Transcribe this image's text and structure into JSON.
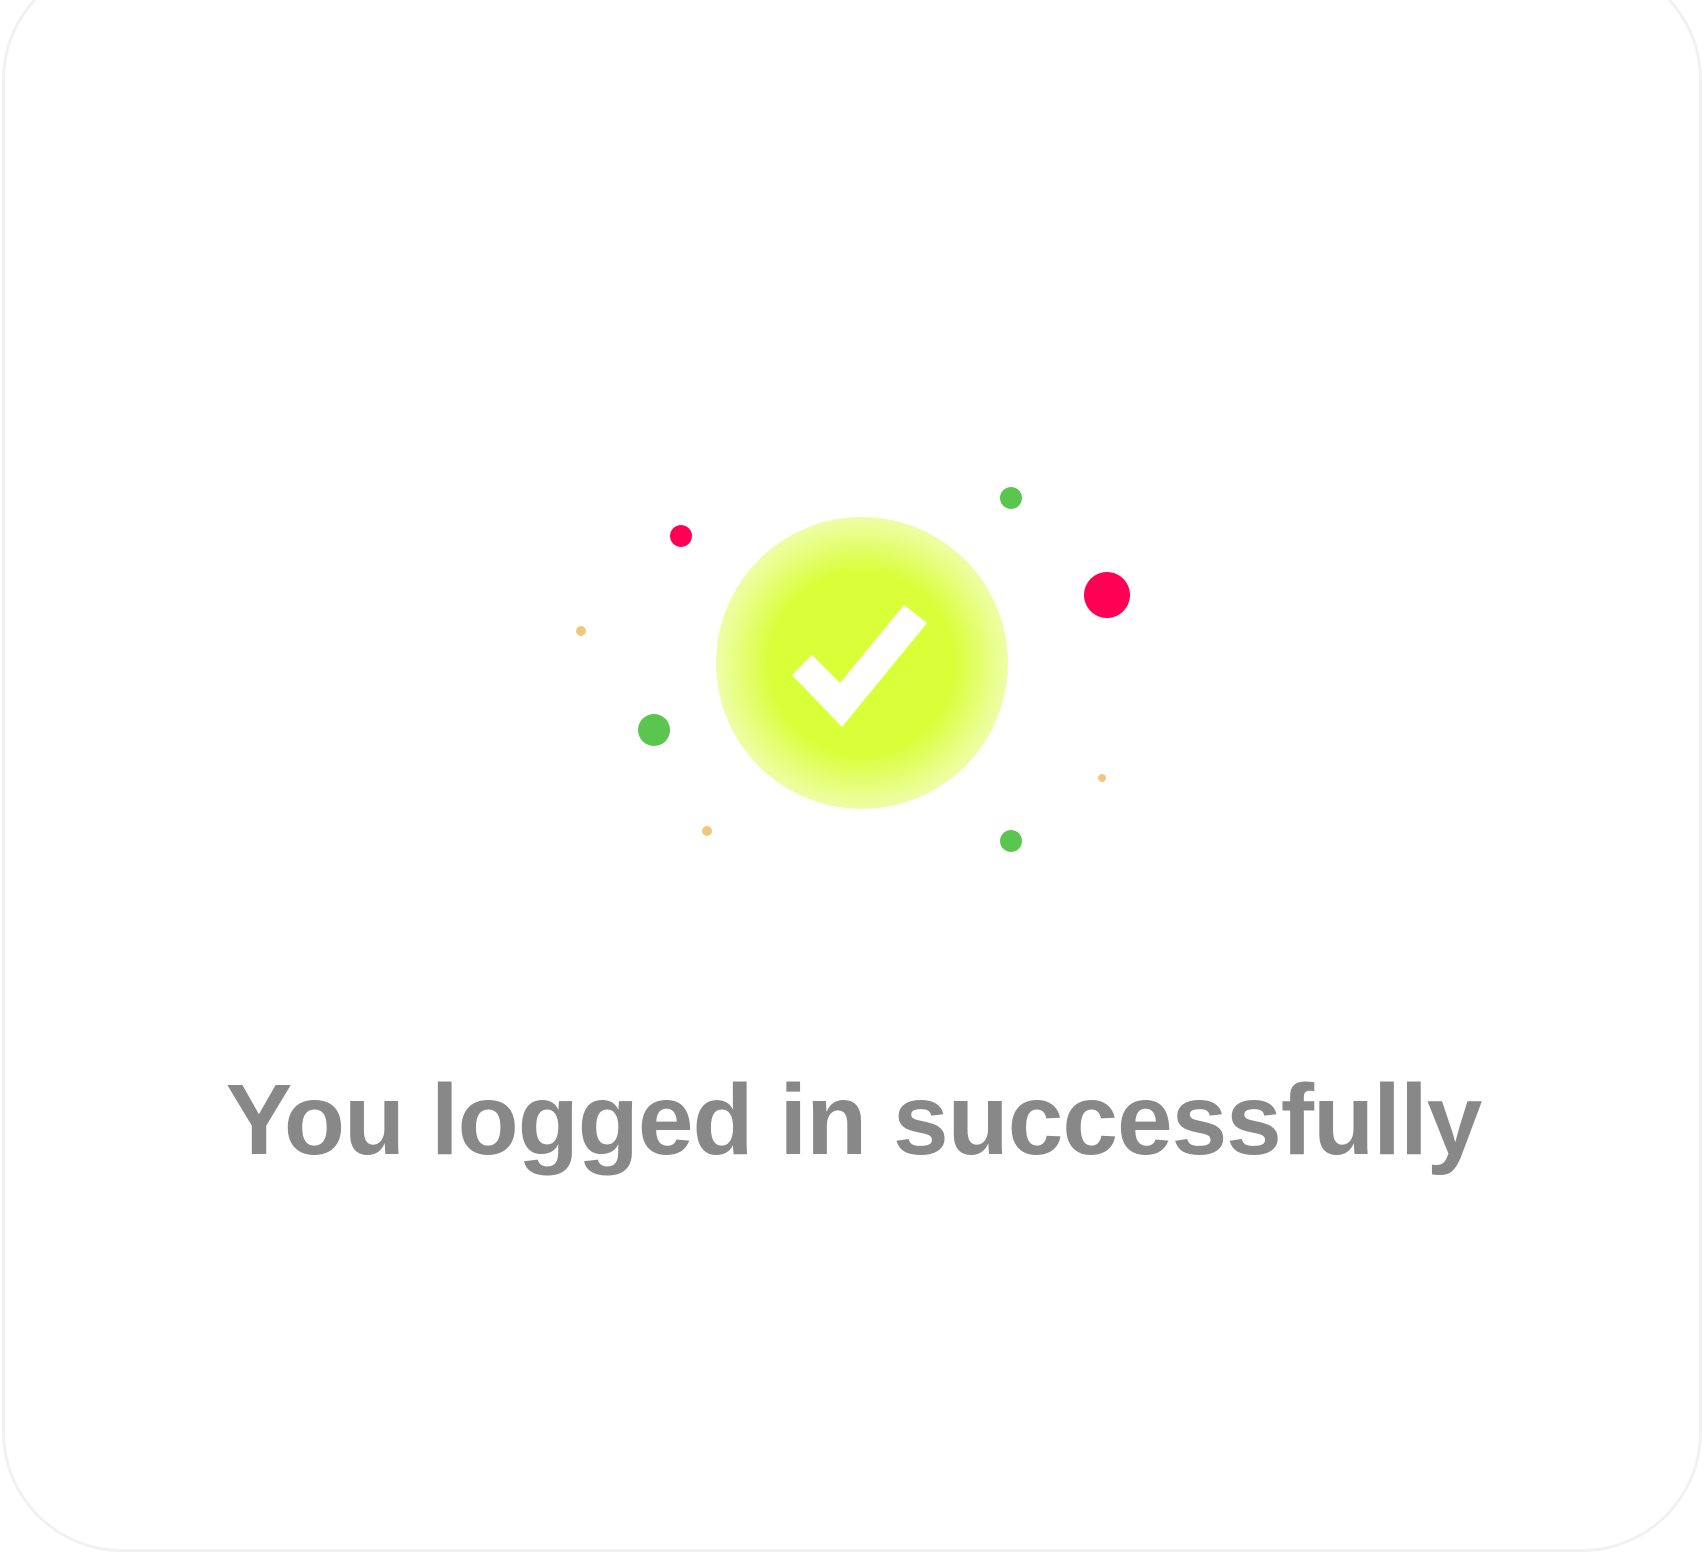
{
  "dialog": {
    "message": "You logged in successfully"
  },
  "icons": {
    "status_icon": "check-circle-icon",
    "decoration": "confetti-dots"
  },
  "colors": {
    "circle": "#d8ff37",
    "circle_edge": "#f0ffb0",
    "check": "#ffffff",
    "dot_pink": "#ff0055",
    "dot_green": "#5ac64f",
    "dot_orange": "#f1c77d",
    "message_text": "#888888",
    "card_border": "#f1f1f1"
  }
}
